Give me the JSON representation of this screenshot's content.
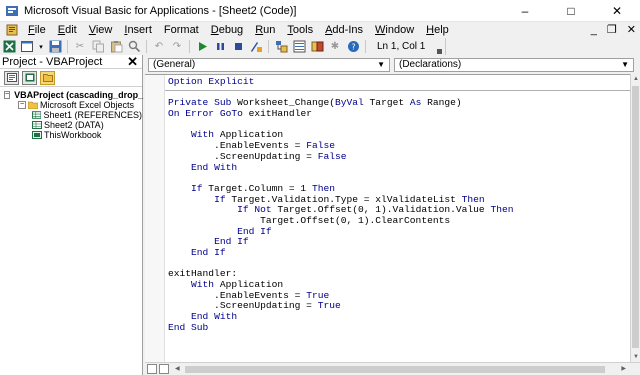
{
  "window": {
    "title": "Microsoft Visual Basic for Applications - [Sheet2 (Code)]",
    "minimize": "–",
    "maximize": "□",
    "close": "✕"
  },
  "menu": {
    "items": [
      {
        "label": "File",
        "acc": "F",
        "rest": "ile"
      },
      {
        "label": "Edit",
        "acc": "E",
        "rest": "dit"
      },
      {
        "label": "View",
        "acc": "V",
        "rest": "iew"
      },
      {
        "label": "Insert",
        "acc": "I",
        "rest": "nsert"
      },
      {
        "label": "Format",
        "acc": "",
        "rest": "Format"
      },
      {
        "label": "Debug",
        "acc": "D",
        "rest": "ebug"
      },
      {
        "label": "Run",
        "acc": "R",
        "rest": "un"
      },
      {
        "label": "Tools",
        "acc": "T",
        "rest": "ools"
      },
      {
        "label": "Add-Ins",
        "acc": "A",
        "rest": "dd-Ins"
      },
      {
        "label": "Window",
        "acc": "W",
        "rest": "indow"
      },
      {
        "label": "Help",
        "acc": "H",
        "rest": "elp"
      }
    ],
    "mdi_minimize": "_",
    "mdi_restore": "❐",
    "mdi_close": "✕"
  },
  "toolbar": {
    "position": "Ln 1, Col 1"
  },
  "project": {
    "title": "Project - VBAProject",
    "close": "✕",
    "tree": {
      "root": "VBAProject (cascading_drop_",
      "folder": "Microsoft Excel Objects",
      "items": [
        "Sheet1 (REFERENCES)",
        "Sheet2 (DATA)",
        "ThisWorkbook"
      ]
    }
  },
  "code_window": {
    "object_dropdown": "(General)",
    "procedure_dropdown": "(Declarations)",
    "lines": [
      "Option Explicit",
      "",
      "Private Sub Worksheet_Change(ByVal Target As Range)",
      "On Error GoTo exitHandler",
      "",
      "    With Application",
      "        .EnableEvents = False",
      "        .ScreenUpdating = False",
      "    End With",
      "",
      "    If Target.Column = 1 Then",
      "        If Target.Validation.Type = xlValidateList Then",
      "            If Not Target.Offset(0, 1).Validation.Value Then",
      "                Target.Offset(0, 1).ClearContents",
      "            End If",
      "        End If",
      "    End If",
      "",
      "exitHandler:",
      "    With Application",
      "        .EnableEvents = True",
      "        .ScreenUpdating = True",
      "    End With",
      "End Sub"
    ]
  },
  "colors": {
    "keyword": "#00008b",
    "text": "#000000"
  }
}
